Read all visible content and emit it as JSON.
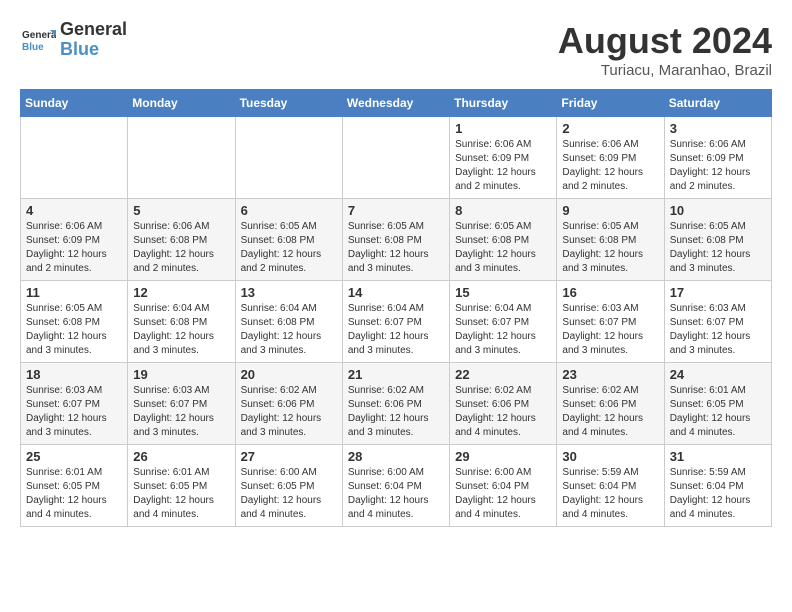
{
  "header": {
    "logo_line1": "General",
    "logo_line2": "Blue",
    "month": "August 2024",
    "location": "Turiacu, Maranhao, Brazil"
  },
  "weekdays": [
    "Sunday",
    "Monday",
    "Tuesday",
    "Wednesday",
    "Thursday",
    "Friday",
    "Saturday"
  ],
  "weeks": [
    [
      {
        "day": "",
        "info": ""
      },
      {
        "day": "",
        "info": ""
      },
      {
        "day": "",
        "info": ""
      },
      {
        "day": "",
        "info": ""
      },
      {
        "day": "1",
        "info": "Sunrise: 6:06 AM\nSunset: 6:09 PM\nDaylight: 12 hours and 2 minutes."
      },
      {
        "day": "2",
        "info": "Sunrise: 6:06 AM\nSunset: 6:09 PM\nDaylight: 12 hours and 2 minutes."
      },
      {
        "day": "3",
        "info": "Sunrise: 6:06 AM\nSunset: 6:09 PM\nDaylight: 12 hours and 2 minutes."
      }
    ],
    [
      {
        "day": "4",
        "info": "Sunrise: 6:06 AM\nSunset: 6:09 PM\nDaylight: 12 hours and 2 minutes."
      },
      {
        "day": "5",
        "info": "Sunrise: 6:06 AM\nSunset: 6:08 PM\nDaylight: 12 hours and 2 minutes."
      },
      {
        "day": "6",
        "info": "Sunrise: 6:05 AM\nSunset: 6:08 PM\nDaylight: 12 hours and 2 minutes."
      },
      {
        "day": "7",
        "info": "Sunrise: 6:05 AM\nSunset: 6:08 PM\nDaylight: 12 hours and 3 minutes."
      },
      {
        "day": "8",
        "info": "Sunrise: 6:05 AM\nSunset: 6:08 PM\nDaylight: 12 hours and 3 minutes."
      },
      {
        "day": "9",
        "info": "Sunrise: 6:05 AM\nSunset: 6:08 PM\nDaylight: 12 hours and 3 minutes."
      },
      {
        "day": "10",
        "info": "Sunrise: 6:05 AM\nSunset: 6:08 PM\nDaylight: 12 hours and 3 minutes."
      }
    ],
    [
      {
        "day": "11",
        "info": "Sunrise: 6:05 AM\nSunset: 6:08 PM\nDaylight: 12 hours and 3 minutes."
      },
      {
        "day": "12",
        "info": "Sunrise: 6:04 AM\nSunset: 6:08 PM\nDaylight: 12 hours and 3 minutes."
      },
      {
        "day": "13",
        "info": "Sunrise: 6:04 AM\nSunset: 6:08 PM\nDaylight: 12 hours and 3 minutes."
      },
      {
        "day": "14",
        "info": "Sunrise: 6:04 AM\nSunset: 6:07 PM\nDaylight: 12 hours and 3 minutes."
      },
      {
        "day": "15",
        "info": "Sunrise: 6:04 AM\nSunset: 6:07 PM\nDaylight: 12 hours and 3 minutes."
      },
      {
        "day": "16",
        "info": "Sunrise: 6:03 AM\nSunset: 6:07 PM\nDaylight: 12 hours and 3 minutes."
      },
      {
        "day": "17",
        "info": "Sunrise: 6:03 AM\nSunset: 6:07 PM\nDaylight: 12 hours and 3 minutes."
      }
    ],
    [
      {
        "day": "18",
        "info": "Sunrise: 6:03 AM\nSunset: 6:07 PM\nDaylight: 12 hours and 3 minutes."
      },
      {
        "day": "19",
        "info": "Sunrise: 6:03 AM\nSunset: 6:07 PM\nDaylight: 12 hours and 3 minutes."
      },
      {
        "day": "20",
        "info": "Sunrise: 6:02 AM\nSunset: 6:06 PM\nDaylight: 12 hours and 3 minutes."
      },
      {
        "day": "21",
        "info": "Sunrise: 6:02 AM\nSunset: 6:06 PM\nDaylight: 12 hours and 3 minutes."
      },
      {
        "day": "22",
        "info": "Sunrise: 6:02 AM\nSunset: 6:06 PM\nDaylight: 12 hours and 4 minutes."
      },
      {
        "day": "23",
        "info": "Sunrise: 6:02 AM\nSunset: 6:06 PM\nDaylight: 12 hours and 4 minutes."
      },
      {
        "day": "24",
        "info": "Sunrise: 6:01 AM\nSunset: 6:05 PM\nDaylight: 12 hours and 4 minutes."
      }
    ],
    [
      {
        "day": "25",
        "info": "Sunrise: 6:01 AM\nSunset: 6:05 PM\nDaylight: 12 hours and 4 minutes."
      },
      {
        "day": "26",
        "info": "Sunrise: 6:01 AM\nSunset: 6:05 PM\nDaylight: 12 hours and 4 minutes."
      },
      {
        "day": "27",
        "info": "Sunrise: 6:00 AM\nSunset: 6:05 PM\nDaylight: 12 hours and 4 minutes."
      },
      {
        "day": "28",
        "info": "Sunrise: 6:00 AM\nSunset: 6:04 PM\nDaylight: 12 hours and 4 minutes."
      },
      {
        "day": "29",
        "info": "Sunrise: 6:00 AM\nSunset: 6:04 PM\nDaylight: 12 hours and 4 minutes."
      },
      {
        "day": "30",
        "info": "Sunrise: 5:59 AM\nSunset: 6:04 PM\nDaylight: 12 hours and 4 minutes."
      },
      {
        "day": "31",
        "info": "Sunrise: 5:59 AM\nSunset: 6:04 PM\nDaylight: 12 hours and 4 minutes."
      }
    ]
  ]
}
